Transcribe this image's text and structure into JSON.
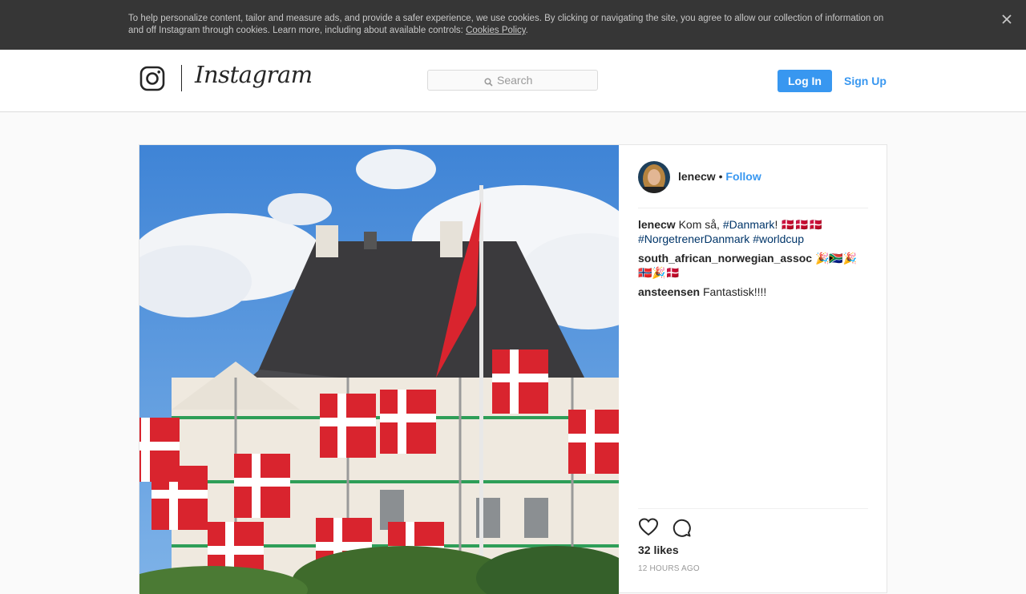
{
  "cookie_banner": {
    "text": "To help personalize content, tailor and measure ads, and provide a safer experience, we use cookies. By clicking or navigating the site, you agree to allow our collection of information on and off Instagram through cookies. Learn more, including about available controls: ",
    "link": "Cookies Policy",
    "period": "."
  },
  "header": {
    "wordmark": "Instagram",
    "search_placeholder": "Search",
    "login_label": "Log In",
    "signup_label": "Sign Up"
  },
  "post": {
    "author": "lenecw",
    "bullet": "•",
    "follow_label": "Follow",
    "comments": [
      {
        "user": "lenecw",
        "text_1": " Kom så, ",
        "tag_1": "#Danmark",
        "text_2": "! ",
        "emoji": "🇩🇰🇩🇰🇩🇰",
        "tag_2": "#NorgetrenerDanmark",
        "tag_3": "#worldcup"
      },
      {
        "user": "south_african_norwegian_assoc",
        "emoji": "🎉🇿🇦🎉🇳🇴🎉🇩🇰"
      },
      {
        "user": "ansteensen",
        "text": "Fantastisk!!!!"
      }
    ],
    "likes": "32 likes",
    "timestamp": "12 HOURS AGO"
  },
  "icons": {
    "close": "close-icon",
    "instagram": "instagram-glyph-icon",
    "search": "search-icon",
    "heart": "heart-icon",
    "comment": "comment-icon"
  },
  "colors": {
    "accent": "#3897f0",
    "hashtag": "#003569",
    "banner_bg": "#363636"
  }
}
